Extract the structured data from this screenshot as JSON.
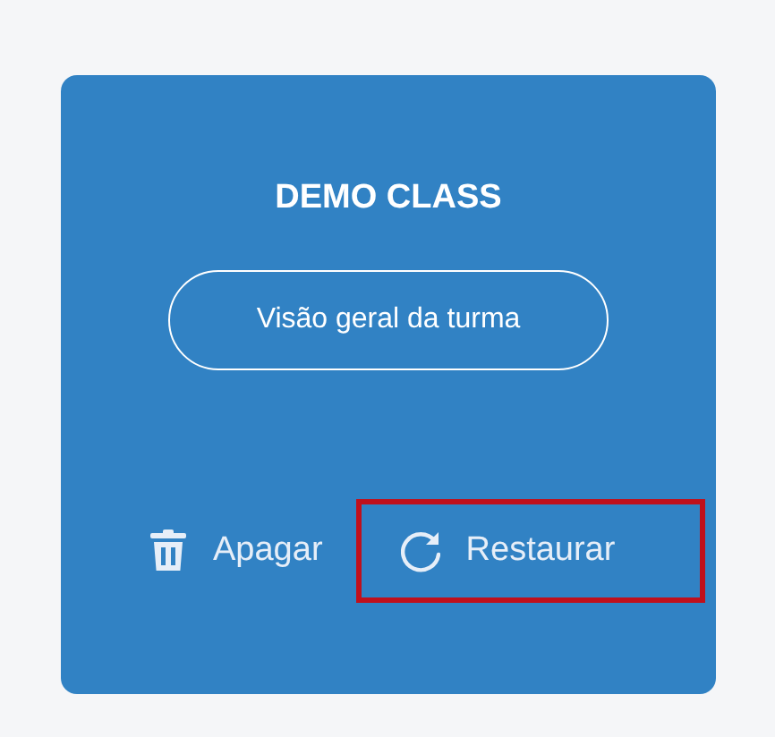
{
  "card": {
    "title": "DEMO CLASS",
    "overview_button": "Visão geral da turma",
    "actions": [
      {
        "kind": "delete",
        "label": "Apagar",
        "highlighted": false
      },
      {
        "kind": "restore",
        "label": "Restaurar",
        "highlighted": true
      }
    ]
  }
}
